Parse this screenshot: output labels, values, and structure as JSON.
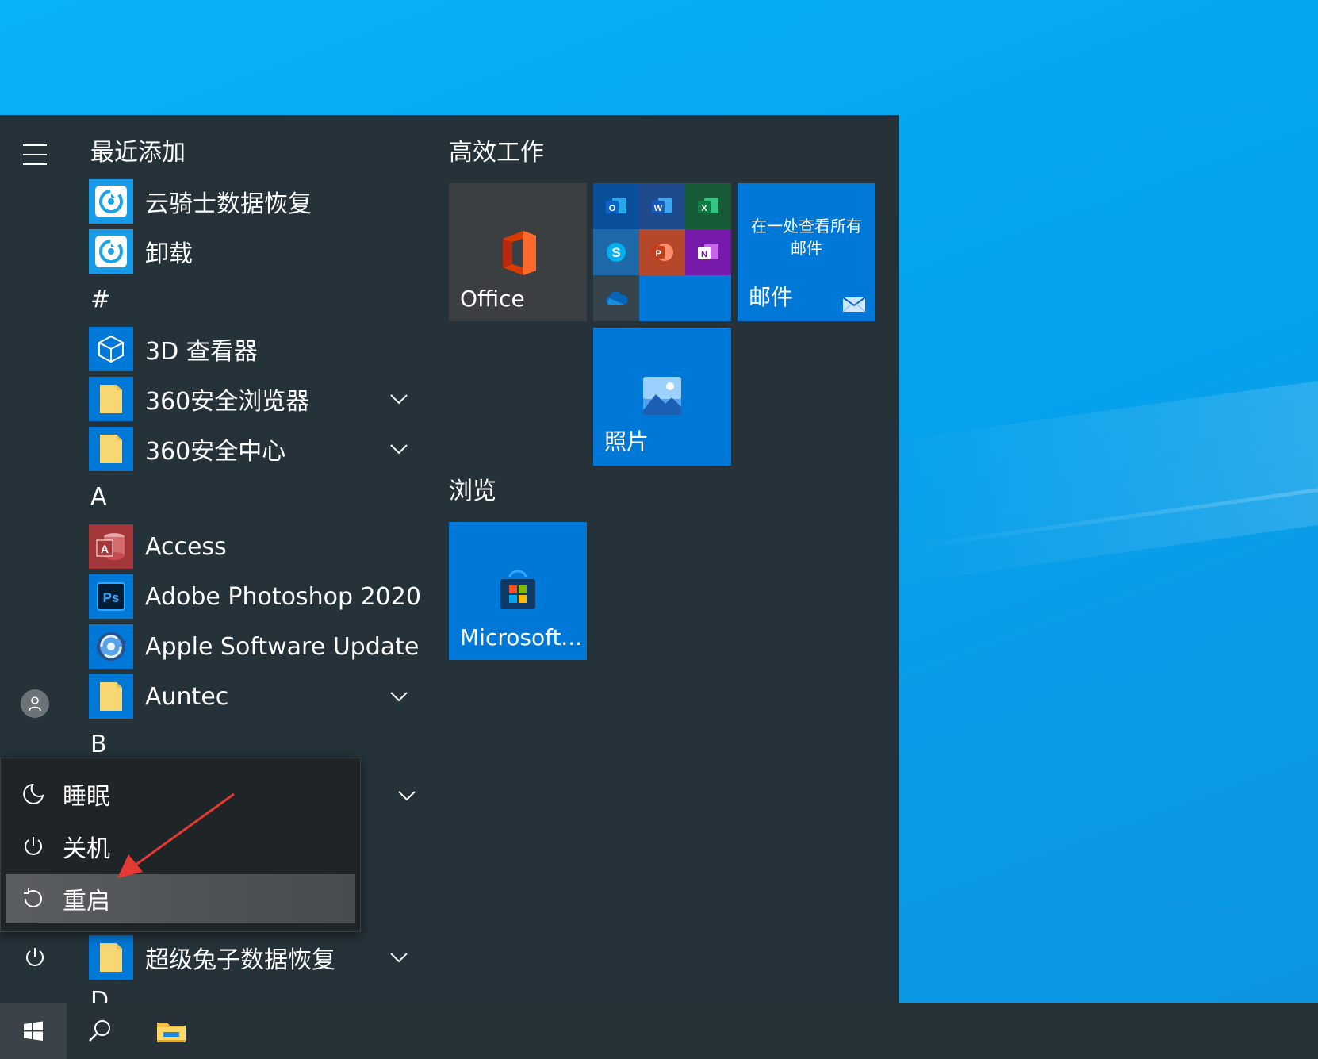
{
  "start_menu": {
    "recent_header": "最近添加",
    "sections": {
      "hash": "#",
      "a": "A",
      "b": "B",
      "d": "D"
    },
    "apps": {
      "yunqishi": "云骑士数据恢复",
      "uninstall": "卸载",
      "viewer3d": "3D 查看器",
      "browser360": "360安全浏览器",
      "security360": "360安全中心",
      "access": "Access",
      "photoshop": "Adobe Photoshop 2020",
      "apple_update": "Apple Software Update",
      "auntec": "Auntec",
      "chaojitu": "超级兔子数据恢复"
    },
    "groups": {
      "productivity": "高效工作",
      "browse": "浏览"
    },
    "tiles": {
      "office": "Office",
      "mail_title": "邮件",
      "mail_desc": "在一处查看所有邮件",
      "photos": "照片",
      "store": "Microsoft..."
    }
  },
  "power_menu": {
    "sleep": "睡眠",
    "shutdown": "关机",
    "restart": "重启"
  },
  "colors": {
    "tile_blue": "#0078d7",
    "menu_bg": "#253239",
    "office_tile": "#3b3f42",
    "annotation_arrow": "#e53935"
  }
}
